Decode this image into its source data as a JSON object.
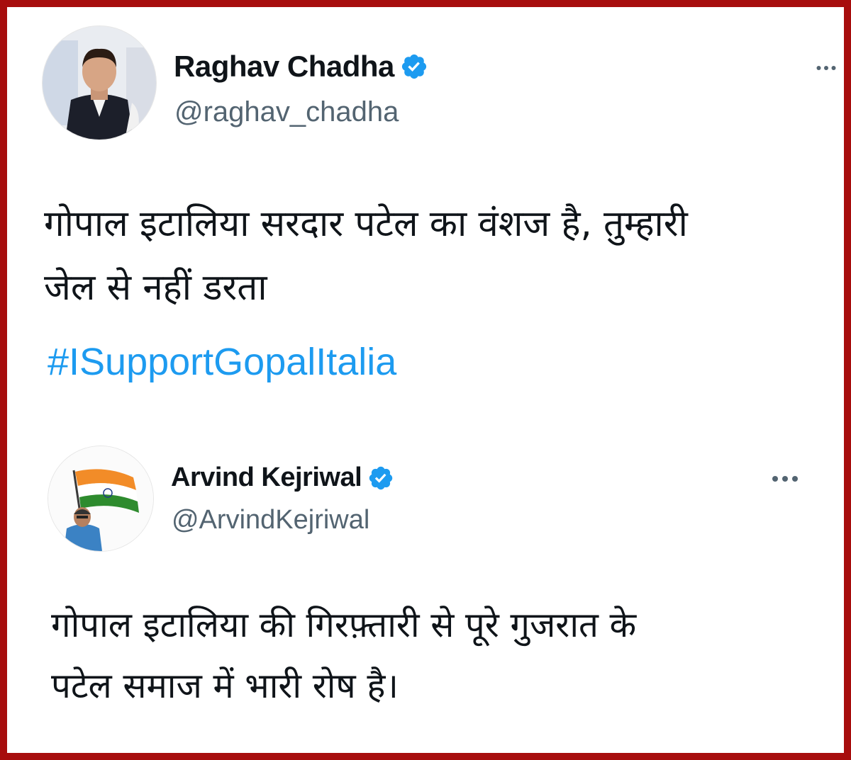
{
  "colors": {
    "frame": "#a70d0d",
    "text": "#0f1419",
    "secondary": "#536471",
    "link": "#1d9bf0",
    "verified": "#1d9bf0"
  },
  "tweets": [
    {
      "author": {
        "name": "Raghav Chadha",
        "handle": "@raghav_chadha",
        "verified": true,
        "avatar_icon": "profile-photo-man-in-black-vest"
      },
      "text_lines": [
        "गोपाल इटालिया सरदार पटेल का वंशज है, तुम्हारी",
        "जेल से नहीं डरता"
      ],
      "hashtag": "#ISupportGopalItalia",
      "menu_icon": "more-options-icon"
    },
    {
      "author": {
        "name": "Arvind Kejriwal",
        "handle": "@ArvindKejriwal",
        "verified": true,
        "avatar_icon": "profile-photo-man-with-indian-flag"
      },
      "text_lines": [
        "गोपाल इटालिया की गिरफ़्तारी से पूरे गुजरात के",
        "पटेल समाज में भारी रोष है।"
      ],
      "menu_icon": "more-options-icon"
    }
  ]
}
